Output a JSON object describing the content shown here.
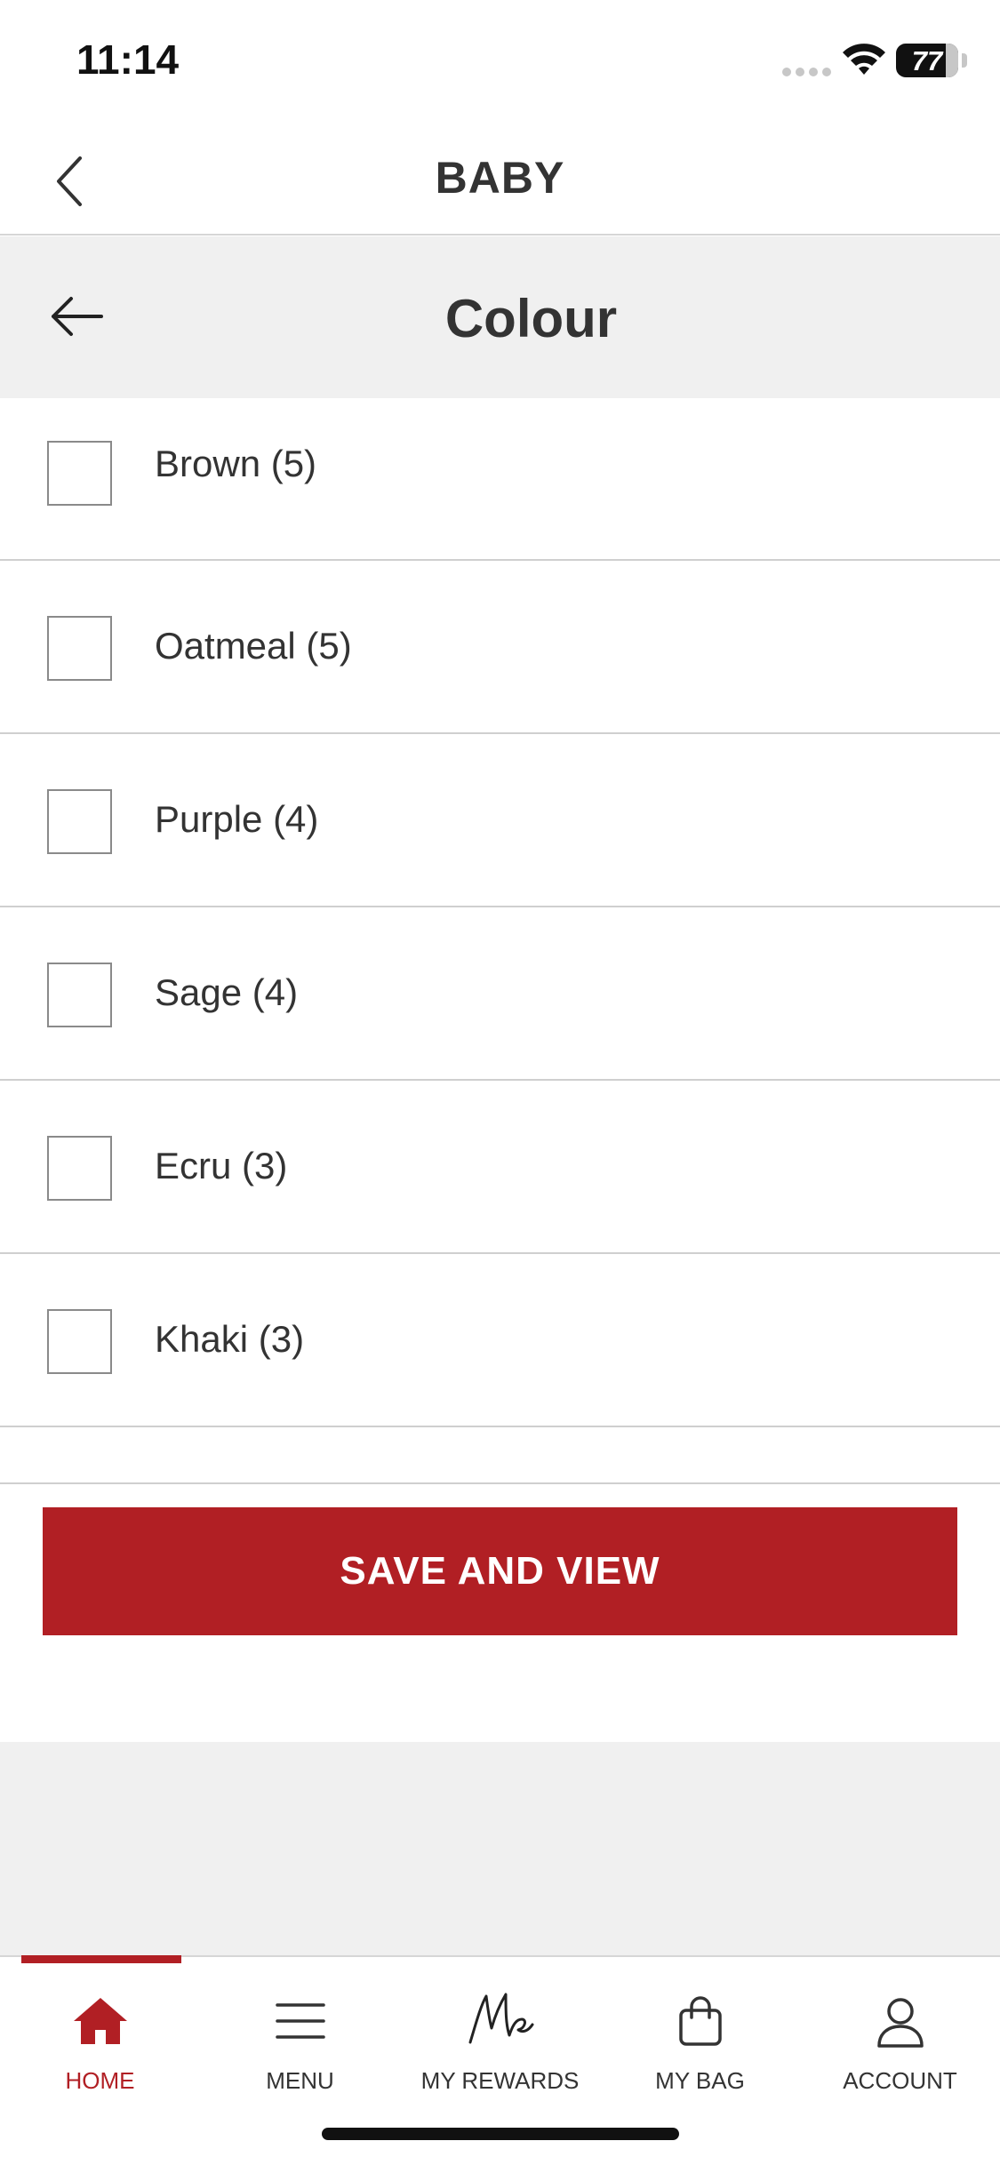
{
  "status_bar": {
    "time": "11:14",
    "battery": "77"
  },
  "header": {
    "title": "BABY"
  },
  "filter": {
    "title": "Colour",
    "options": [
      {
        "label": "Brown (5)",
        "checked": false
      },
      {
        "label": "Oatmeal (5)",
        "checked": false
      },
      {
        "label": "Purple (4)",
        "checked": false
      },
      {
        "label": "Sage (4)",
        "checked": false
      },
      {
        "label": "Ecru (3)",
        "checked": false
      },
      {
        "label": "Khaki (3)",
        "checked": false
      }
    ]
  },
  "actions": {
    "save_label": "SAVE AND VIEW"
  },
  "tabs": [
    {
      "label": "HOME",
      "icon": "home-icon",
      "active": true
    },
    {
      "label": "MENU",
      "icon": "menu-icon",
      "active": false
    },
    {
      "label": "MY REWARDS",
      "icon": "me-rewards-icon",
      "active": false
    },
    {
      "label": "MY BAG",
      "icon": "bag-icon",
      "active": false
    },
    {
      "label": "ACCOUNT",
      "icon": "account-icon",
      "active": false
    }
  ],
  "colors": {
    "accent": "#b11f24",
    "panel": "#f0f0f0",
    "text": "#333333"
  }
}
